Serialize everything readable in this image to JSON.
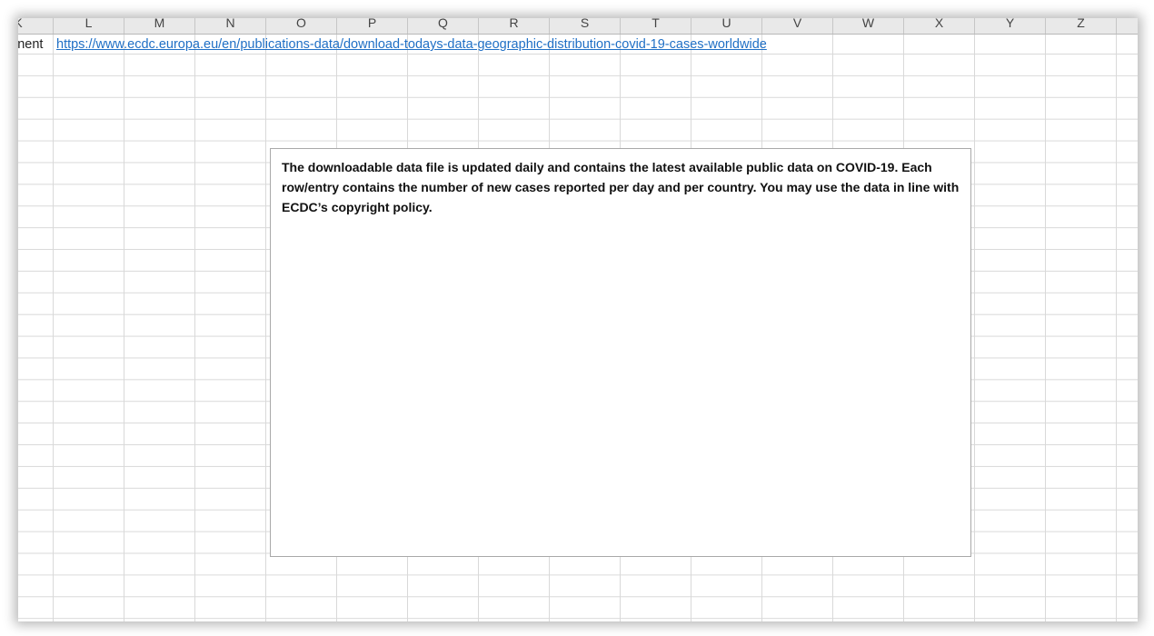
{
  "spreadsheet": {
    "column_headers": [
      "K",
      "L",
      "M",
      "N",
      "O",
      "P",
      "Q",
      "R",
      "S",
      "T",
      "U",
      "V",
      "W",
      "X",
      "Y",
      "Z"
    ],
    "row1": {
      "label_fragment": "inent",
      "link_text": "https://www.ecdc.europa.eu/en/publications-data/download-todays-data-geographic-distribution-covid-19-cases-worldwide"
    },
    "textbox": {
      "text": "The downloadable data file is updated daily and contains the latest available public data on COVID-19. Each row/entry contains the number of new cases reported per day and per country. You may use the data in line with ECDC’s copyright policy."
    }
  },
  "colors": {
    "link": "#1f6fc5",
    "gridline": "#d9d9d9",
    "header_bg": "#e9e9e9",
    "textbox_border": "#a9a9a9"
  }
}
